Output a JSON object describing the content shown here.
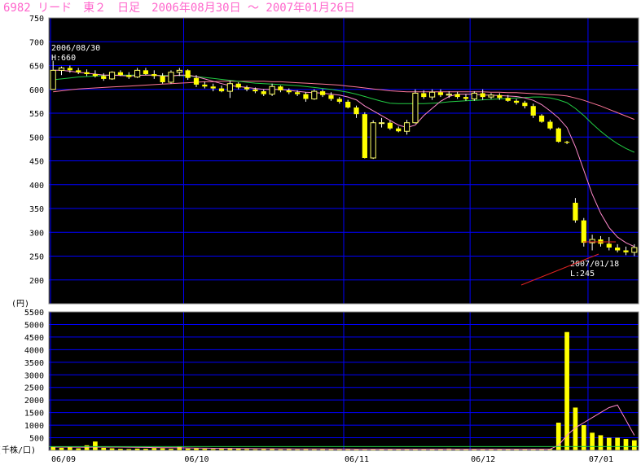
{
  "title": "6982 リード　東２　日足　2006年08月30日 ～ 2007年01月26日",
  "colors": {
    "background": "#000000",
    "grid": "#0000ff",
    "candle_up": "#ffff66",
    "candle_down": "#ffff00",
    "ma_short": "#ff88cc",
    "ma_mid": "#22cc44",
    "ma_long": "#ff7799",
    "volume": "#ffff00",
    "title": "#ff66cc",
    "arrow": "#dd2222"
  },
  "chart_data": [
    {
      "type": "candlestick",
      "ylim": [
        150,
        750
      ],
      "yticks": [
        "750",
        "700",
        "650",
        "600",
        "550",
        "500",
        "450",
        "400",
        "350",
        "300",
        "250",
        "200"
      ],
      "unit_label": "(円)",
      "annotations": {
        "high_date": "2006/08/30",
        "high_label": "H:660",
        "low_date": "2007/01/18",
        "low_label": "L:245"
      },
      "candles": [
        [
          600,
          660,
          600,
          640
        ],
        [
          640,
          648,
          630,
          645
        ],
        [
          645,
          650,
          635,
          640
        ],
        [
          640,
          645,
          632,
          636
        ],
        [
          636,
          642,
          628,
          632
        ],
        [
          632,
          640,
          625,
          628
        ],
        [
          628,
          634,
          618,
          622
        ],
        [
          622,
          638,
          620,
          636
        ],
        [
          636,
          640,
          628,
          630
        ],
        [
          630,
          636,
          622,
          626
        ],
        [
          626,
          645,
          624,
          640
        ],
        [
          640,
          645,
          630,
          632
        ],
        [
          632,
          640,
          622,
          628
        ],
        [
          628,
          634,
          612,
          615
        ],
        [
          615,
          640,
          612,
          636
        ],
        [
          636,
          645,
          628,
          640
        ],
        [
          640,
          642,
          620,
          624
        ],
        [
          624,
          630,
          605,
          610
        ],
        [
          610,
          616,
          602,
          606
        ],
        [
          606,
          612,
          596,
          602
        ],
        [
          602,
          608,
          594,
          596
        ],
        [
          596,
          618,
          582,
          612
        ],
        [
          612,
          615,
          600,
          604
        ],
        [
          604,
          608,
          596,
          600
        ],
        [
          600,
          604,
          592,
          596
        ],
        [
          596,
          600,
          586,
          590
        ],
        [
          590,
          612,
          586,
          606
        ],
        [
          606,
          608,
          594,
          598
        ],
        [
          598,
          602,
          590,
          594
        ],
        [
          594,
          598,
          586,
          590
        ],
        [
          590,
          594,
          574,
          580
        ],
        [
          580,
          600,
          578,
          596
        ],
        [
          596,
          600,
          584,
          588
        ],
        [
          588,
          594,
          576,
          580
        ],
        [
          580,
          584,
          570,
          574
        ],
        [
          574,
          578,
          560,
          562
        ],
        [
          562,
          566,
          540,
          548
        ],
        [
          548,
          552,
          455,
          456
        ],
        [
          456,
          535,
          454,
          530
        ],
        [
          530,
          540,
          520,
          530
        ],
        [
          530,
          534,
          515,
          518
        ],
        [
          518,
          522,
          510,
          512
        ],
        [
          512,
          536,
          505,
          530
        ],
        [
          530,
          600,
          528,
          592
        ],
        [
          592,
          598,
          580,
          584
        ],
        [
          584,
          600,
          578,
          594
        ],
        [
          594,
          600,
          584,
          588
        ],
        [
          588,
          596,
          582,
          590
        ],
        [
          590,
          595,
          580,
          584
        ],
        [
          584,
          590,
          576,
          580
        ],
        [
          580,
          596,
          576,
          592
        ],
        [
          592,
          600,
          578,
          584
        ],
        [
          584,
          592,
          580,
          588
        ],
        [
          588,
          592,
          578,
          582
        ],
        [
          582,
          588,
          574,
          576
        ],
        [
          576,
          580,
          568,
          572
        ],
        [
          572,
          576,
          560,
          565
        ],
        [
          565,
          570,
          540,
          545
        ],
        [
          545,
          548,
          530,
          532
        ],
        [
          532,
          536,
          515,
          518
        ],
        [
          518,
          520,
          488,
          490
        ],
        [
          490,
          492,
          485,
          488
        ],
        [
          362,
          372,
          320,
          325
        ],
        [
          325,
          330,
          270,
          278
        ],
        [
          278,
          295,
          262,
          285
        ],
        [
          285,
          292,
          270,
          276
        ],
        [
          276,
          290,
          262,
          268
        ],
        [
          268,
          275,
          258,
          262
        ],
        [
          262,
          270,
          252,
          258
        ],
        [
          258,
          275,
          250,
          268
        ]
      ],
      "ma_short": [
        640,
        640,
        638,
        636,
        634,
        632,
        630,
        630,
        629,
        628,
        629,
        630,
        630,
        628,
        628,
        630,
        630,
        627,
        622,
        617,
        612,
        608,
        606,
        604,
        602,
        600,
        600,
        600,
        598,
        596,
        594,
        593,
        592,
        590,
        588,
        584,
        578,
        565,
        555,
        545,
        535,
        525,
        520,
        525,
        545,
        560,
        575,
        585,
        590,
        590,
        590,
        588,
        588,
        587,
        586,
        585,
        582,
        577,
        568,
        555,
        540,
        520,
        480,
        430,
        380,
        340,
        310,
        290,
        278,
        270
      ],
      "ma_mid": [
        620,
        622,
        624,
        626,
        627,
        628,
        629,
        630,
        630,
        630,
        630,
        630,
        630,
        629,
        629,
        629,
        628,
        627,
        625,
        623,
        621,
        619,
        617,
        615,
        613,
        612,
        611,
        610,
        609,
        608,
        606,
        604,
        602,
        600,
        597,
        594,
        590,
        585,
        580,
        575,
        571,
        570,
        570,
        570,
        570,
        571,
        572,
        574,
        575,
        576,
        577,
        578,
        579,
        580,
        581,
        582,
        583,
        584,
        584,
        582,
        578,
        572,
        560,
        545,
        528,
        512,
        498,
        486,
        476,
        468
      ],
      "ma_long": [
        595,
        597,
        599,
        601,
        602,
        603,
        604,
        605,
        606,
        607,
        608,
        609,
        610,
        611,
        612,
        613,
        614,
        615,
        616,
        616,
        617,
        617,
        617,
        617,
        617,
        617,
        616,
        616,
        615,
        614,
        613,
        612,
        611,
        610,
        609,
        607,
        605,
        603,
        601,
        599,
        597,
        596,
        595,
        595,
        595,
        595,
        595,
        595,
        595,
        595,
        595,
        595,
        594,
        594,
        593,
        593,
        592,
        591,
        590,
        589,
        588,
        586,
        582,
        577,
        571,
        565,
        558,
        551,
        544,
        537
      ]
    },
    {
      "type": "bar",
      "ylim": [
        0,
        5500
      ],
      "yticks": [
        "5500",
        "5000",
        "4500",
        "4000",
        "3500",
        "3000",
        "2500",
        "2000",
        "1500",
        "1000",
        "500"
      ],
      "unit_label": "(千株/口)",
      "x_ticks": [
        "06/09",
        "06/10",
        "06/11",
        "06/12",
        "07/01"
      ],
      "volumes": [
        150,
        100,
        120,
        80,
        200,
        350,
        100,
        80,
        60,
        50,
        70,
        60,
        90,
        80,
        60,
        140,
        70,
        80,
        60,
        50,
        60,
        90,
        70,
        50,
        40,
        60,
        50,
        40,
        50,
        40,
        50,
        40,
        60,
        50,
        40,
        60,
        40,
        30,
        50,
        40,
        60,
        40,
        50,
        60,
        40,
        50,
        60,
        70,
        40,
        50,
        40,
        60,
        50,
        40,
        50,
        40,
        50,
        40,
        60,
        50,
        1100,
        4700,
        1700,
        1000,
        700,
        600,
        500,
        500,
        450,
        400
      ],
      "volume_ma": [
        130,
        130,
        130,
        125,
        125,
        130,
        130,
        130,
        128,
        125,
        120,
        115,
        110,
        108,
        105,
        100,
        95,
        90,
        85,
        80,
        78,
        75,
        72,
        70,
        68,
        66,
        64,
        62,
        60,
        58,
        56,
        55,
        54,
        53,
        52,
        51,
        50,
        50,
        50,
        50,
        50,
        50,
        50,
        50,
        50,
        50,
        50,
        50,
        50,
        50,
        50,
        50,
        50,
        50,
        50,
        50,
        50,
        50,
        50,
        50,
        200,
        600,
        900,
        1100,
        1300,
        1500,
        1700,
        1800,
        1200,
        600
      ]
    }
  ]
}
